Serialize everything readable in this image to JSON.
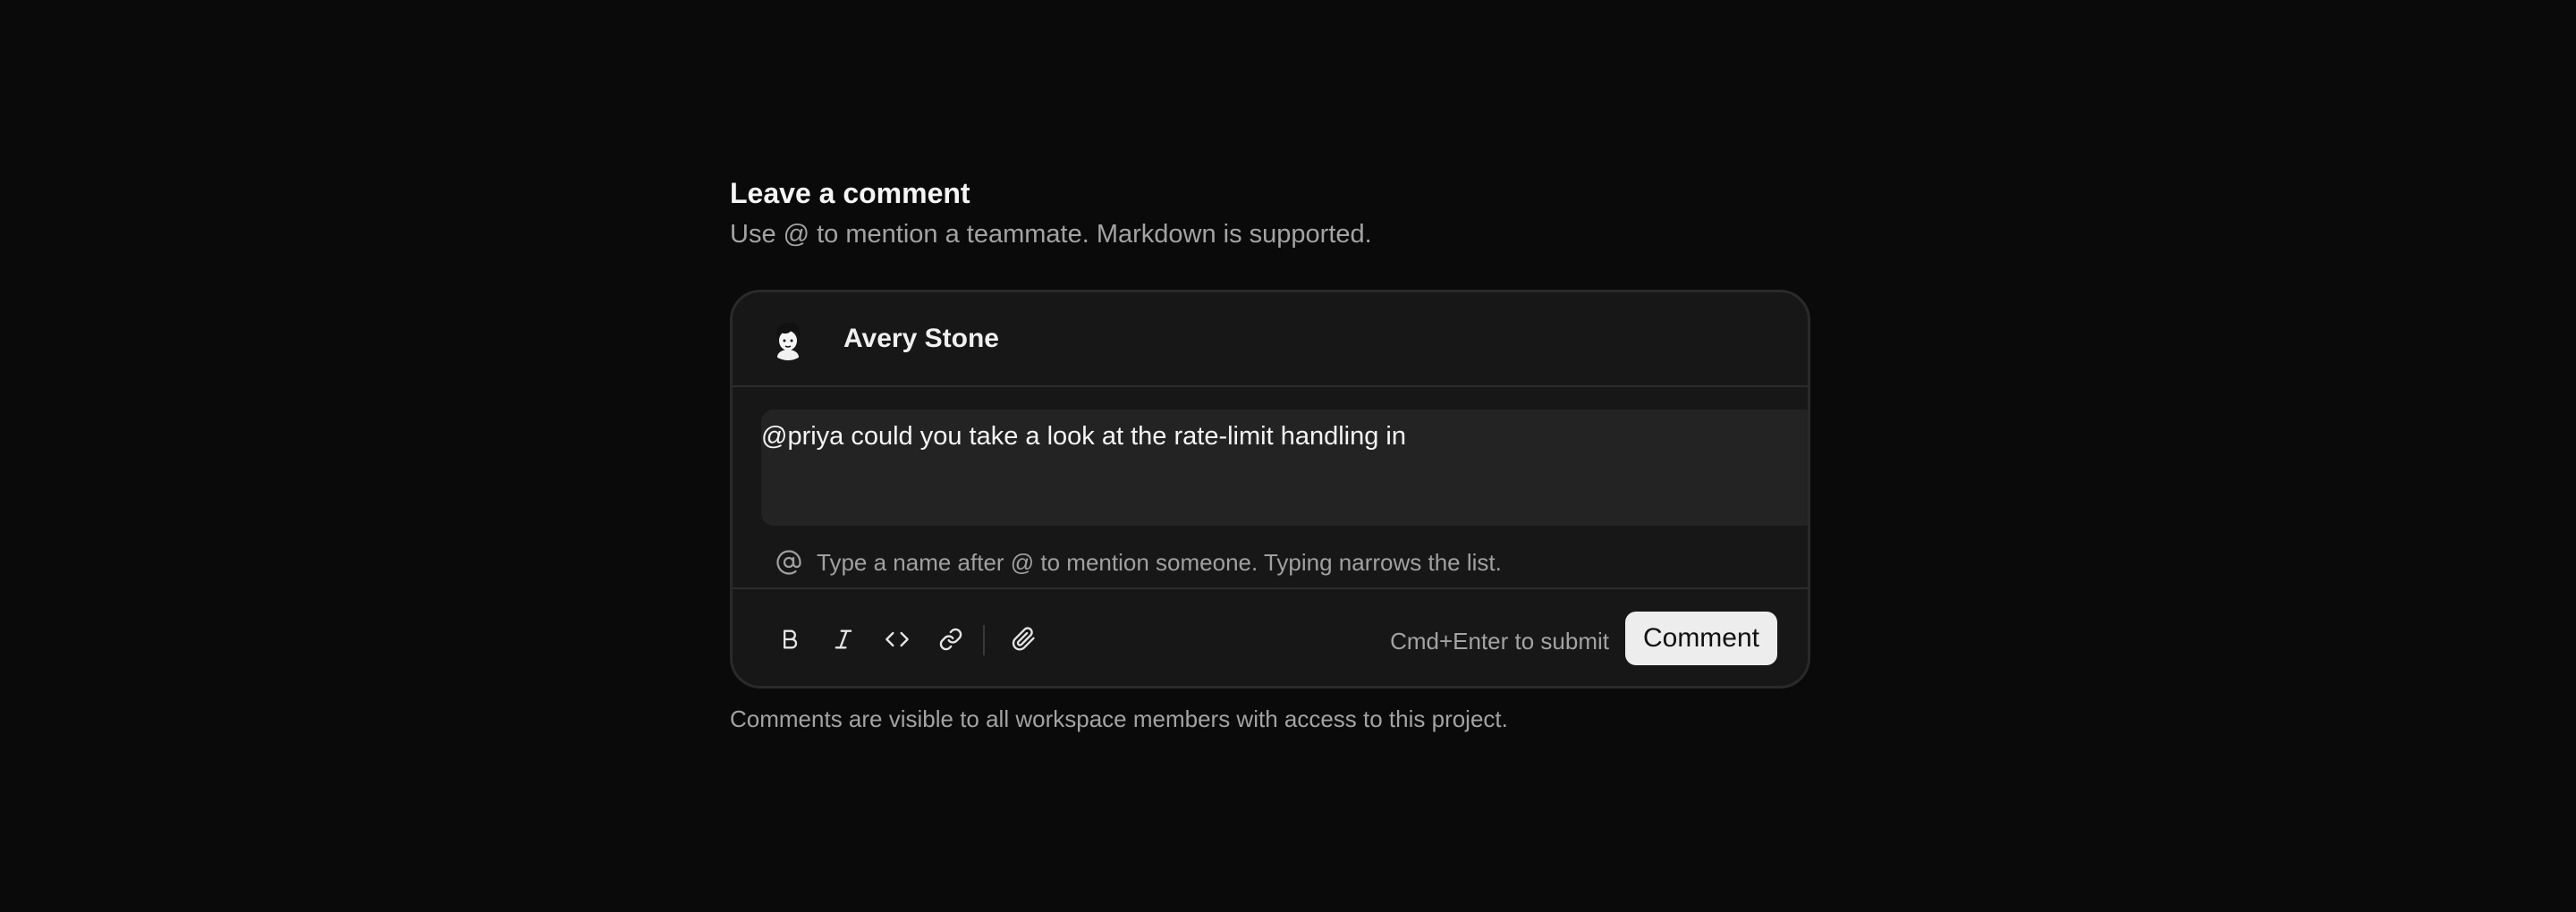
{
  "header": {
    "title": "Leave a comment",
    "subtitle": "Use @ to mention a teammate. Markdown is supported."
  },
  "composer": {
    "author_name": "Avery Stone",
    "avatar_icon": "avatar-illustration",
    "text": "@priya could you take a look at the rate-limit handling in",
    "mention_hint": "Type a name after @ to mention someone. Typing narrows the list.",
    "toolbar": {
      "bold_icon": "bold-icon",
      "italic_icon": "italic-icon",
      "code_icon": "code-icon",
      "link_icon": "link-icon",
      "attach_icon": "paperclip-icon"
    },
    "submit_hint": "Cmd+Enter to submit",
    "submit_label": "Comment"
  },
  "footnote": "Comments are visible to all workspace members with access to this project.",
  "colors": {
    "background": "#0a0a0a",
    "card": "#171717",
    "editor": "#232323",
    "button": "#ededed",
    "muted_text": "#a3a3a3"
  }
}
